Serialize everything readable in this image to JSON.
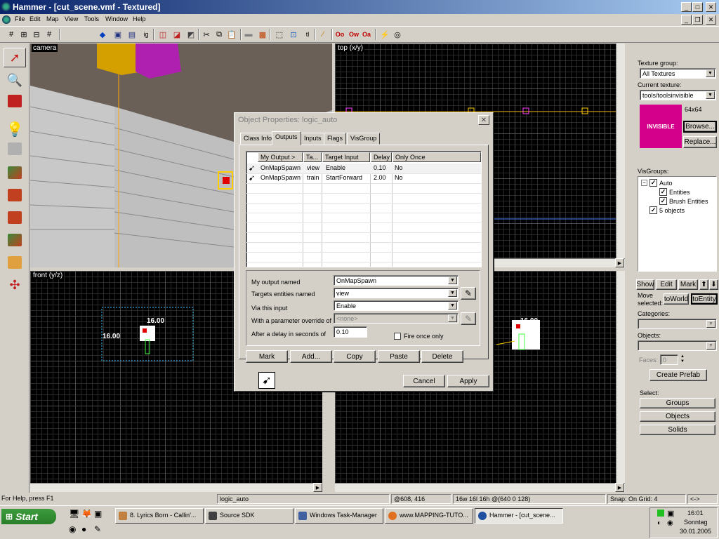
{
  "window": {
    "title": "Hammer - [cut_scene.vmf - Textured]",
    "controls": {
      "minimize": "_",
      "maximize": "□",
      "close": "✕"
    }
  },
  "menu": [
    "File",
    "Edit",
    "Map",
    "View",
    "Tools",
    "Window",
    "Help"
  ],
  "viewports": {
    "camera": {
      "label": "camera"
    },
    "top": {
      "label": "top (x/y)"
    },
    "front": {
      "label": "front (y/z)",
      "dim_h": "16.00",
      "dim_w": "16.00"
    },
    "side": {
      "dim_w": "16.00"
    }
  },
  "dialog": {
    "title": "Object Properties: logic_auto",
    "tabs": [
      "Class Info",
      "Outputs",
      "Inputs",
      "Flags",
      "VisGroup"
    ],
    "active_tab": "Outputs",
    "columns": [
      "My Output  >",
      "Ta...",
      "Target Input",
      "Delay",
      "Only Once"
    ],
    "rows": [
      {
        "output": "OnMapSpawn",
        "target": "view",
        "input": "Enable",
        "delay": "0.10",
        "once": "No"
      },
      {
        "output": "OnMapSpawn",
        "target": "train",
        "input": "StartForward",
        "delay": "2.00",
        "once": "No"
      }
    ],
    "fields": {
      "my_output_label": "My output named",
      "my_output_value": "OnMapSpawn",
      "targets_label": "Targets entities named",
      "targets_value": "view",
      "via_input_label": "Via this input",
      "via_input_value": "Enable",
      "param_label": "With a parameter override of",
      "param_value": "<none>",
      "delay_label": "After a delay in seconds of",
      "delay_value": "0.10",
      "fire_once_label": "Fire once only"
    },
    "buttons": {
      "mark": "Mark",
      "add": "Add...",
      "copy": "Copy",
      "paste": "Paste",
      "delete": "Delete",
      "cancel": "Cancel",
      "apply": "Apply"
    }
  },
  "rightpanel": {
    "texture_group_label": "Texture group:",
    "texture_group_value": "All Textures",
    "current_texture_label": "Current texture:",
    "current_texture_value": "tools/toolsinvisible",
    "texture_size": "64x64",
    "texture_preview_text": "INVISIBLE",
    "texture_preview_color": "#d4008c",
    "browse": "Browse...",
    "replace": "Replace...",
    "visgroups_label": "VisGroups:",
    "visgroups": [
      {
        "label": "Auto",
        "indent": 0
      },
      {
        "label": "Entities",
        "indent": 1
      },
      {
        "label": "Brush Entities",
        "indent": 1
      },
      {
        "label": "5 objects",
        "indent": 0
      }
    ],
    "show": "Show",
    "edit": "Edit",
    "mark": "Mark",
    "move_selected_label": "Move selected:",
    "to_world": "toWorld",
    "to_entity": "toEntity",
    "categories_label": "Categories:",
    "objects_label": "Objects:",
    "faces_label": "Faces:",
    "faces_value": "0",
    "create_prefab": "Create Prefab",
    "select_label": "Select:",
    "groups": "Groups",
    "objects_btn": "Objects",
    "solids": "Solids"
  },
  "status": {
    "help": "For Help, press F1",
    "selection": "logic_auto",
    "coords": "@608, 416",
    "size": "16w 16l 16h @(640 0 128)",
    "snap": "Snap: On Grid: 4",
    "nav": "<->"
  },
  "taskbar": {
    "start": "Start",
    "tasks": [
      {
        "label": "8. Lyrics Born - Callin'...",
        "icon_color": "#c08040"
      },
      {
        "label": "Source SDK",
        "icon_color": "#404040"
      },
      {
        "label": "Windows Task-Manager",
        "icon_color": "#4060a0"
      },
      {
        "label": "www.MAPPING-TUTO...",
        "icon_color": "#e07020"
      },
      {
        "label": "Hammer - [cut_scene...",
        "icon_color": "#2050a0"
      }
    ],
    "time": "16:01",
    "day": "Sonntag",
    "date": "30.01.2005"
  },
  "colors": {
    "accent": "#0a246a",
    "selection_yellow": "#ffcc00",
    "entity_pink": "#ff40ff",
    "vis_cyan": "#40c0ff"
  }
}
